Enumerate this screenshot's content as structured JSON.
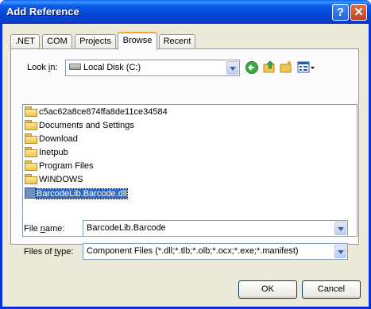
{
  "window": {
    "title": "Add Reference",
    "help_glyph": "?",
    "close_glyph": "✕"
  },
  "tabs": [
    {
      "label": ".NET",
      "active": false
    },
    {
      "label": "COM",
      "active": false
    },
    {
      "label": "Projects",
      "active": false
    },
    {
      "label": "Browse",
      "active": true
    },
    {
      "label": "Recent",
      "active": false
    }
  ],
  "look_in": {
    "label_prefix": "Look ",
    "label_key": "i",
    "label_suffix": "n:",
    "value": "Local Disk (C:)"
  },
  "toolbar": {
    "icons": [
      "back-icon",
      "up-folder-icon",
      "new-folder-icon",
      "view-menu-icon"
    ]
  },
  "files": [
    {
      "name": "c5ac62a8ce874ffa8de11ce34584",
      "type": "folder",
      "selected": false
    },
    {
      "name": "Documents and Settings",
      "type": "folder",
      "selected": false
    },
    {
      "name": "Download",
      "type": "folder",
      "selected": false
    },
    {
      "name": "Inetpub",
      "type": "folder",
      "selected": false
    },
    {
      "name": "Program Files",
      "type": "folder",
      "selected": false
    },
    {
      "name": "WINDOWS",
      "type": "folder",
      "selected": false
    },
    {
      "name": "BarcodeLib.Barcode.dll",
      "type": "dll",
      "selected": true
    }
  ],
  "file_name": {
    "label_prefix": "File ",
    "label_key": "n",
    "label_suffix": "ame:",
    "value": "BarcodeLib.Barcode"
  },
  "file_type": {
    "label_prefix": "Files of ",
    "label_key": "t",
    "label_suffix": "ype:",
    "value": "Component Files (*.dll;*.tlb;*.olb;*.ocx;*.exe;*.manifest)"
  },
  "buttons": {
    "ok": "OK",
    "cancel": "Cancel"
  },
  "colors": {
    "title_bar": "#0a5ae8",
    "dialog_bg": "#ece9d8",
    "selection": "#316ac5",
    "active_tab_accent": "#f5a623"
  }
}
